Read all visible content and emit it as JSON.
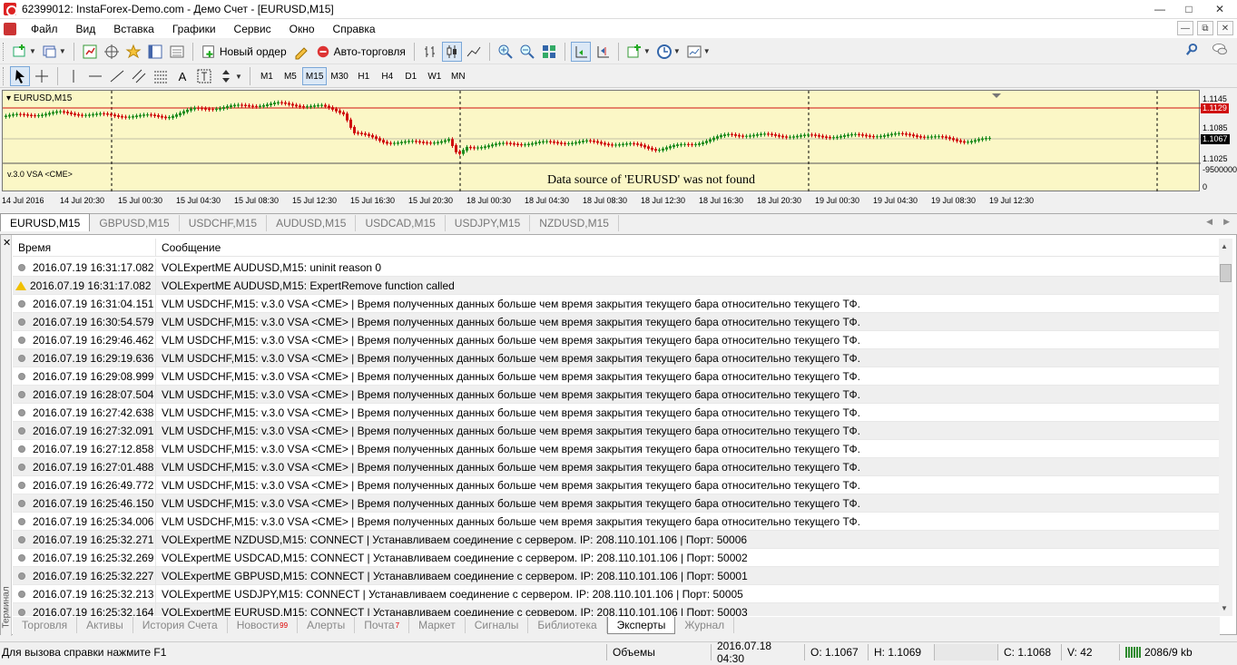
{
  "window": {
    "title": "62399012: InstaForex-Demo.com - Демо Счет - [EURUSD,M15]"
  },
  "menu": [
    "Файл",
    "Вид",
    "Вставка",
    "Графики",
    "Сервис",
    "Окно",
    "Справка"
  ],
  "toolbar": {
    "new_order": "Новый ордер",
    "auto_trading": "Авто-торговля"
  },
  "timeframes": [
    "M1",
    "M5",
    "M15",
    "M30",
    "H1",
    "H4",
    "D1",
    "W1",
    "MN"
  ],
  "active_timeframe": "M15",
  "chart": {
    "label": "EURUSD,M15",
    "indicator_label": "v.3.0 VSA <CME>",
    "no_data_message": "Data source of 'EURUSD' was not found",
    "price_ticks": [
      "1.1145",
      "1.1085",
      "1.1025"
    ],
    "price_high_tag": "1.1129",
    "price_current_tag": "1.1067",
    "indicator_ticks": [
      "-9500000",
      "0"
    ],
    "time_labels": [
      "14 Jul 2016",
      "14 Jul 20:30",
      "15 Jul 00:30",
      "15 Jul 04:30",
      "15 Jul 08:30",
      "15 Jul 12:30",
      "15 Jul 16:30",
      "15 Jul 20:30",
      "18 Jul 00:30",
      "18 Jul 04:30",
      "18 Jul 08:30",
      "18 Jul 12:30",
      "18 Jul 16:30",
      "18 Jul 20:30",
      "19 Jul 00:30",
      "19 Jul 04:30",
      "19 Jul 08:30",
      "19 Jul 12:30"
    ],
    "colors": {
      "bull": "#1e8c1e",
      "bear": "#d01010",
      "background": "#fbf7c6",
      "high_line": "#d01010"
    }
  },
  "symbol_tabs": [
    "EURUSD,M15",
    "GBPUSD,M15",
    "USDCHF,M15",
    "AUDUSD,M15",
    "USDCAD,M15",
    "USDJPY,M15",
    "NZDUSD,M15"
  ],
  "log": {
    "col_time": "Время",
    "col_message": "Сообщение",
    "rows": [
      {
        "time": "2016.07.19 16:31:17.082",
        "msg": "VOLExpertME AUDUSD,M15: uninit reason 0",
        "level": "info"
      },
      {
        "time": "2016.07.19 16:31:17.082",
        "msg": "VOLExpertME AUDUSD,M15: ExpertRemove function called",
        "level": "warn"
      },
      {
        "time": "2016.07.19 16:31:04.151",
        "msg": "VLM USDCHF,M15: v.3.0 VSA <CME> | Время полученных данных больше чем время закрытия текущего бара относительно текущего ТФ.",
        "level": "info"
      },
      {
        "time": "2016.07.19 16:30:54.579",
        "msg": "VLM USDCHF,M15: v.3.0 VSA <CME> | Время полученных данных больше чем время закрытия текущего бара относительно текущего ТФ.",
        "level": "info"
      },
      {
        "time": "2016.07.19 16:29:46.462",
        "msg": "VLM USDCHF,M15: v.3.0 VSA <CME> | Время полученных данных больше чем время закрытия текущего бара относительно текущего ТФ.",
        "level": "info"
      },
      {
        "time": "2016.07.19 16:29:19.636",
        "msg": "VLM USDCHF,M15: v.3.0 VSA <CME> | Время полученных данных больше чем время закрытия текущего бара относительно текущего ТФ.",
        "level": "info"
      },
      {
        "time": "2016.07.19 16:29:08.999",
        "msg": "VLM USDCHF,M15: v.3.0 VSA <CME> | Время полученных данных больше чем время закрытия текущего бара относительно текущего ТФ.",
        "level": "info"
      },
      {
        "time": "2016.07.19 16:28:07.504",
        "msg": "VLM USDCHF,M15: v.3.0 VSA <CME> | Время полученных данных больше чем время закрытия текущего бара относительно текущего ТФ.",
        "level": "info"
      },
      {
        "time": "2016.07.19 16:27:42.638",
        "msg": "VLM USDCHF,M15: v.3.0 VSA <CME> | Время полученных данных больше чем время закрытия текущего бара относительно текущего ТФ.",
        "level": "info"
      },
      {
        "time": "2016.07.19 16:27:32.091",
        "msg": "VLM USDCHF,M15: v.3.0 VSA <CME> | Время полученных данных больше чем время закрытия текущего бара относительно текущего ТФ.",
        "level": "info"
      },
      {
        "time": "2016.07.19 16:27:12.858",
        "msg": "VLM USDCHF,M15: v.3.0 VSA <CME> | Время полученных данных больше чем время закрытия текущего бара относительно текущего ТФ.",
        "level": "info"
      },
      {
        "time": "2016.07.19 16:27:01.488",
        "msg": "VLM USDCHF,M15: v.3.0 VSA <CME> | Время полученных данных больше чем время закрытия текущего бара относительно текущего ТФ.",
        "level": "info"
      },
      {
        "time": "2016.07.19 16:26:49.772",
        "msg": "VLM USDCHF,M15: v.3.0 VSA <CME> | Время полученных данных больше чем время закрытия текущего бара относительно текущего ТФ.",
        "level": "info"
      },
      {
        "time": "2016.07.19 16:25:46.150",
        "msg": "VLM USDCHF,M15: v.3.0 VSA <CME> | Время полученных данных больше чем время закрытия текущего бара относительно текущего ТФ.",
        "level": "info"
      },
      {
        "time": "2016.07.19 16:25:34.006",
        "msg": "VLM USDCHF,M15: v.3.0 VSA <CME> | Время полученных данных больше чем время закрытия текущего бара относительно текущего ТФ.",
        "level": "info"
      },
      {
        "time": "2016.07.19 16:25:32.271",
        "msg": "VOLExpertME NZDUSD,M15: CONNECT | Устанавливаем соединение с сервером. IP: 208.110.101.106 | Порт: 50006",
        "level": "info"
      },
      {
        "time": "2016.07.19 16:25:32.269",
        "msg": "VOLExpertME USDCAD,M15: CONNECT | Устанавливаем соединение с сервером. IP: 208.110.101.106 | Порт: 50002",
        "level": "info"
      },
      {
        "time": "2016.07.19 16:25:32.227",
        "msg": "VOLExpertME GBPUSD,M15: CONNECT | Устанавливаем соединение с сервером. IP: 208.110.101.106 | Порт: 50001",
        "level": "info"
      },
      {
        "time": "2016.07.19 16:25:32.213",
        "msg": "VOLExpertME USDJPY,M15: CONNECT | Устанавливаем соединение с сервером. IP: 208.110.101.106 | Порт: 50005",
        "level": "info"
      },
      {
        "time": "2016.07.19 16:25:32.164",
        "msg": "VOLExpertME EURUSD,M15: CONNECT | Устанавливаем соединение с сервером. IP: 208.110.101.106 | Порт: 50003",
        "level": "info"
      }
    ]
  },
  "terminal": {
    "side_label": "Терминал",
    "tabs": [
      {
        "label": "Торговля",
        "badge": ""
      },
      {
        "label": "Активы",
        "badge": ""
      },
      {
        "label": "История Счета",
        "badge": ""
      },
      {
        "label": "Новости",
        "badge": "99"
      },
      {
        "label": "Алерты",
        "badge": ""
      },
      {
        "label": "Почта",
        "badge": "7"
      },
      {
        "label": "Маркет",
        "badge": ""
      },
      {
        "label": "Сигналы",
        "badge": ""
      },
      {
        "label": "Библиотека",
        "badge": ""
      },
      {
        "label": "Эксперты",
        "badge": ""
      },
      {
        "label": "Журнал",
        "badge": ""
      }
    ],
    "active_tab": "Эксперты"
  },
  "status": {
    "help": "Для вызова справки нажмите F1",
    "profile": "Объемы",
    "datetime": "2016.07.18 04:30",
    "open": "O: 1.1067",
    "high": "H: 1.1069",
    "close": "C: 1.1068",
    "volume": "V: 42",
    "traffic": "2086/9 kb"
  }
}
